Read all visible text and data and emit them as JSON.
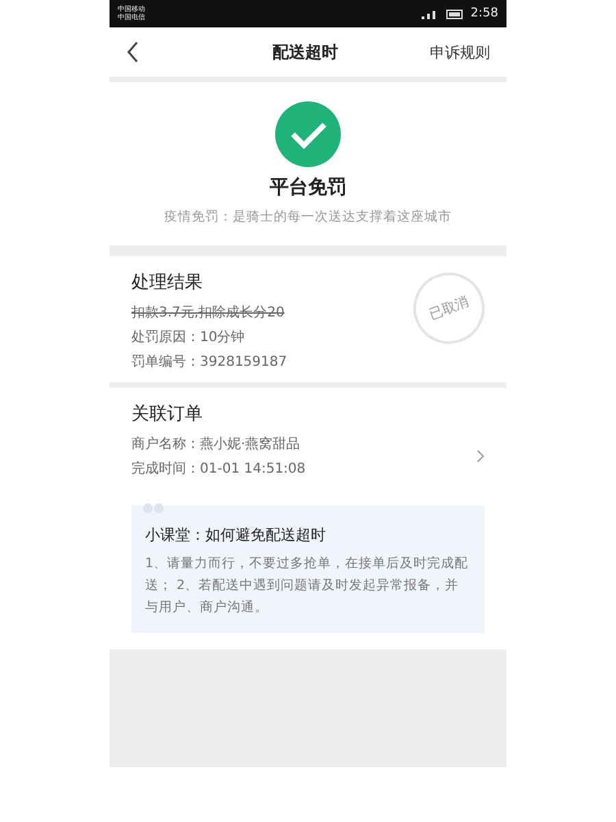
{
  "status_bar": {
    "carriers": [
      "中国移动",
      "中国电信"
    ],
    "time": "2:58"
  },
  "nav": {
    "title": "配送超时",
    "action": "申诉规则"
  },
  "result_header": {
    "title": "平台免罚",
    "subtitle": "疫情免罚：是骑士的每一次送达支撑着这座城市"
  },
  "penalty": {
    "title": "处理结果",
    "stamp": "已取消",
    "lines": [
      {
        "text": "扣款3.7元,扣除成长分20",
        "struck": true
      },
      {
        "text": "处罚原因：10分钟",
        "struck": false
      },
      {
        "text": "罚单编号：3928159187",
        "struck": false
      }
    ]
  },
  "order": {
    "title": "关联订单",
    "lines": [
      "商户名称：燕小妮·燕窝甜品",
      "完成时间：01-01 14:51:08"
    ]
  },
  "tip": {
    "title": "小课堂：如何避免配送超时",
    "body": "1、请量力而行，不要过多抢单，在接单后及时完成配送； 2、若配送中遇到问题请及时发起异常报备，并与用户、商户沟通。"
  }
}
